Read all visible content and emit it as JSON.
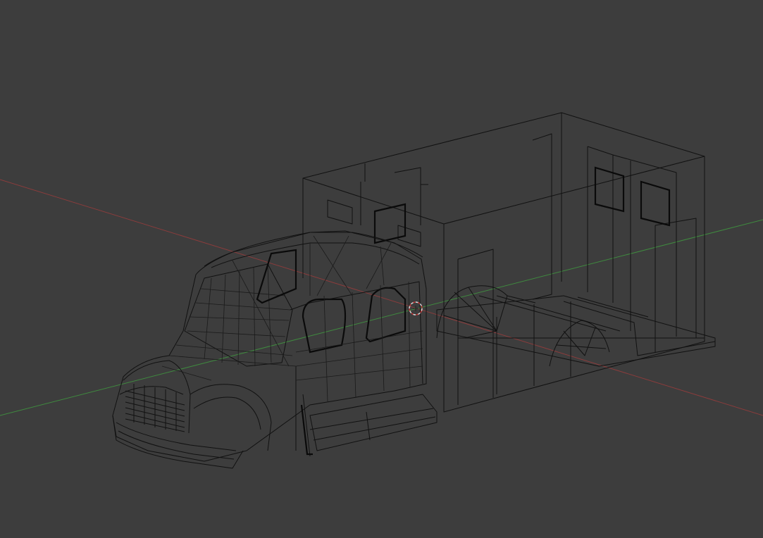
{
  "viewport": {
    "background": "#3d3d3d",
    "mode": "wireframe"
  },
  "axes": {
    "x_axis_color": "#8a3c3c",
    "y_axis_color": "#3f8a3f"
  },
  "cursor": {
    "icon": "3d-cursor-icon",
    "color_outer": "#d9d9d9",
    "color_accent": "#c83232"
  },
  "objects": [
    {
      "name": "ambulance-cab-mesh",
      "type": "truck-cab"
    },
    {
      "name": "ambulance-box-body",
      "type": "rear-compartment"
    },
    {
      "name": "chassis-frame",
      "type": "frame"
    }
  ]
}
